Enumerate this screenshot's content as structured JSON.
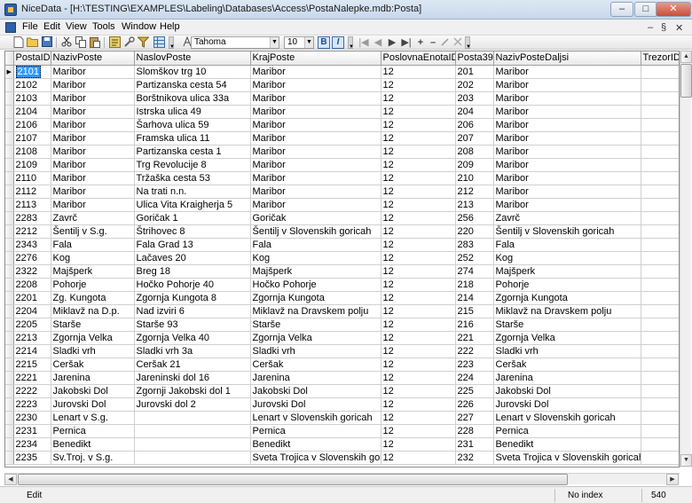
{
  "window": {
    "title": "NiceData - [H:\\TESTING\\EXAMPLES\\Labeling\\Databases\\Access\\PostaNalepke.mdb:Posta]",
    "minimize_glyph": "–",
    "maximize_glyph": "□",
    "close_glyph": "✕"
  },
  "menu": {
    "items": [
      {
        "label": "File"
      },
      {
        "label": "Edit"
      },
      {
        "label": "View"
      },
      {
        "label": "Tools"
      },
      {
        "label": "Window"
      },
      {
        "label": "Help"
      }
    ],
    "mdi_minimize": "–",
    "mdi_restore": "§",
    "mdi_close": "✕"
  },
  "toolbar": {
    "font_name": "Tahoma",
    "font_size": "10",
    "bold_label": "B",
    "italic_label": "I",
    "nav_first": "|◀",
    "nav_prev": "◀",
    "nav_next": "▶",
    "nav_last": "▶|",
    "nav_add": "+",
    "nav_delete": "–"
  },
  "grid": {
    "columns": [
      "PostaID",
      "NazivPoste",
      "NaslovPoste",
      "KrajPoste",
      "PoslovnaEnotaID",
      "Posta39",
      "NazivPosteDaljsi",
      "TrezorID"
    ],
    "rows": [
      [
        "2101",
        "Maribor",
        "Slomškov trg 10",
        "Maribor",
        "12",
        "201",
        "Maribor",
        ""
      ],
      [
        "2102",
        "Maribor",
        "Partizanska cesta 54",
        "Maribor",
        "12",
        "202",
        "Maribor",
        ""
      ],
      [
        "2103",
        "Maribor",
        "Borštnikova ulica 33a",
        "Maribor",
        "12",
        "203",
        "Maribor",
        ""
      ],
      [
        "2104",
        "Maribor",
        "Istrska ulica 49",
        "Maribor",
        "12",
        "204",
        "Maribor",
        ""
      ],
      [
        "2106",
        "Maribor",
        "Šarhova ulica 59",
        "Maribor",
        "12",
        "206",
        "Maribor",
        ""
      ],
      [
        "2107",
        "Maribor",
        "Framska ulica 11",
        "Maribor",
        "12",
        "207",
        "Maribor",
        ""
      ],
      [
        "2108",
        "Maribor",
        "Partizanska cesta 1",
        "Maribor",
        "12",
        "208",
        "Maribor",
        ""
      ],
      [
        "2109",
        "Maribor",
        "Trg Revolucije 8",
        "Maribor",
        "12",
        "209",
        "Maribor",
        ""
      ],
      [
        "2110",
        "Maribor",
        "Tržaška cesta 53",
        "Maribor",
        "12",
        "210",
        "Maribor",
        ""
      ],
      [
        "2112",
        "Maribor",
        "Na trati n.n.",
        "Maribor",
        "12",
        "212",
        "Maribor",
        ""
      ],
      [
        "2113",
        "Maribor",
        "Ulica Vita Kraigherja 5",
        "Maribor",
        "12",
        "213",
        "Maribor",
        ""
      ],
      [
        "2283",
        "Zavrč",
        "Goričak 1",
        "Goričak",
        "12",
        "256",
        "Zavrč",
        ""
      ],
      [
        "2212",
        "Šentilj v S.g.",
        "Štrihovec 8",
        "Šentilj v Slovenskih goricah",
        "12",
        "220",
        "Šentilj v Slovenskih goricah",
        ""
      ],
      [
        "2343",
        "Fala",
        "Fala Grad 13",
        "Fala",
        "12",
        "283",
        "Fala",
        ""
      ],
      [
        "2276",
        "Kog",
        "Lačaves 20",
        "Kog",
        "12",
        "252",
        "Kog",
        ""
      ],
      [
        "2322",
        "Majšperk",
        "Breg 18",
        "Majšperk",
        "12",
        "274",
        "Majšperk",
        ""
      ],
      [
        "2208",
        "Pohorje",
        "Hočko Pohorje 40",
        "Hočko Pohorje",
        "12",
        "218",
        "Pohorje",
        ""
      ],
      [
        "2201",
        "Zg. Kungota",
        "Zgornja Kungota 8",
        "Zgornja Kungota",
        "12",
        "214",
        "Zgornja Kungota",
        ""
      ],
      [
        "2204",
        "Miklavž na D.p.",
        "Nad izviri 6",
        "Miklavž na Dravskem polju",
        "12",
        "215",
        "Miklavž na Dravskem polju",
        ""
      ],
      [
        "2205",
        "Starše",
        "Starše 93",
        "Starše",
        "12",
        "216",
        "Starše",
        ""
      ],
      [
        "2213",
        "Zgornja Velka",
        "Zgornja Velka 40",
        "Zgornja Velka",
        "12",
        "221",
        "Zgornja Velka",
        ""
      ],
      [
        "2214",
        "Sladki vrh",
        "Sladki vrh 3a",
        "Sladki vrh",
        "12",
        "222",
        "Sladki vrh",
        ""
      ],
      [
        "2215",
        "Ceršak",
        "Ceršak 21",
        "Ceršak",
        "12",
        "223",
        "Ceršak",
        ""
      ],
      [
        "2221",
        "Jarenina",
        "Jareninski dol 16",
        "Jarenina",
        "12",
        "224",
        "Jarenina",
        ""
      ],
      [
        "2222",
        "Jakobski Dol",
        "Zgornji Jakobski dol 1",
        "Jakobski Dol",
        "12",
        "225",
        "Jakobski Dol",
        ""
      ],
      [
        "2223",
        "Jurovski Dol",
        "Jurovski dol 2",
        "Jurovski Dol",
        "12",
        "226",
        "Jurovski Dol",
        ""
      ],
      [
        "2230",
        "Lenart v S.g.",
        "",
        "Lenart v Slovenskih goricah",
        "12",
        "227",
        "Lenart v Slovenskih goricah",
        ""
      ],
      [
        "2231",
        "Pernica",
        "",
        "Pernica",
        "12",
        "228",
        "Pernica",
        ""
      ],
      [
        "2234",
        "Benedikt",
        "",
        "Benedikt",
        "12",
        "231",
        "Benedikt",
        ""
      ],
      [
        "2235",
        "Sv.Troj. v S.g.",
        "",
        "Sveta Trojica v Slovenskih goricah",
        "12",
        "232",
        "Sveta Trojica v Slovenskih goricah",
        ""
      ]
    ],
    "row_indicator": "▶"
  },
  "scroll": {
    "up": "▲",
    "down": "▼",
    "left": "◀",
    "right": "▶"
  },
  "status": {
    "mode": "Edit",
    "index": "No index",
    "record_count": "540"
  }
}
